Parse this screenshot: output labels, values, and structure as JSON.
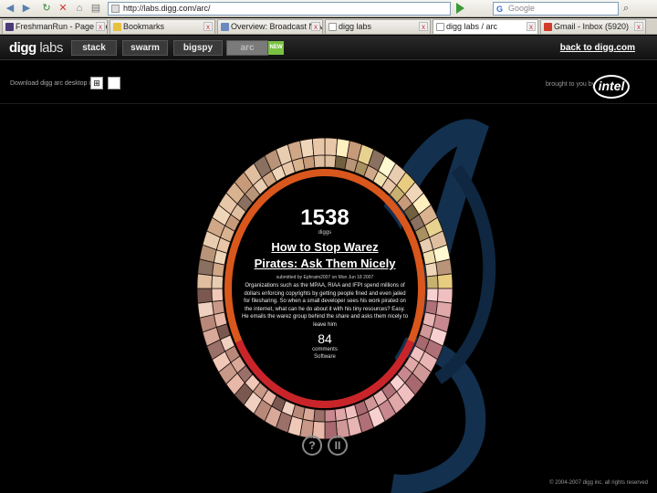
{
  "browser": {
    "url": "http://labs.digg.com/arc/",
    "search_placeholder": "Google",
    "search_engine_letter": "G",
    "tabs": [
      {
        "label": "FreshmanRun - Page ahead bring",
        "color": "#4a3a7a"
      },
      {
        "label": "Bookmarks",
        "color": "#e8c040"
      },
      {
        "label": "Overview: Broadcast Navigation",
        "color": "#6a8ac0"
      },
      {
        "label": "digg labs",
        "color": "#ffffff"
      },
      {
        "label": "digg labs / arc",
        "color": "#ffffff"
      },
      {
        "label": "Gmail - Inbox (5920)",
        "color": "#d23a2a"
      }
    ]
  },
  "header": {
    "logo_digg": "digg",
    "logo_labs": "labs",
    "nav": [
      {
        "label": "stack"
      },
      {
        "label": "swarm"
      },
      {
        "label": "bigspy"
      },
      {
        "label": "arc"
      }
    ],
    "new_badge": "NEW",
    "back_link": "back to digg.com"
  },
  "subbar": {
    "download_text": "Download digg arc desktop in air",
    "brought_by": "brought to you by",
    "sponsor": "intel"
  },
  "story": {
    "digg_count": "1538",
    "diggs_label": "diggs",
    "title_line1": "How to Stop Warez",
    "title_line2": "Pirates: Ask Them Nicely",
    "submitted": "submitted by Ephraim2007 on Mon Jun 18 2007",
    "description": "Organizations such as the MPAA, RIAA and IFPI spend millions of dollars enforcing copyrights by getting people fined and even jailed for filesharing. So when a small developer sees his work pirated on the internet, what can he do about it with his tiny resources? Easy. He emails the warez group behind the share and asks them nicely to leave him",
    "comments_count": "84",
    "comments_label": "comments",
    "category": "Software"
  },
  "controls": {
    "help_symbol": "?",
    "pause_symbol": "II"
  },
  "footer": {
    "copyright": "© 2004-2007 digg inc. all rights reserved"
  },
  "colors": {
    "background": "#000000",
    "swirl": "#1a3a5c",
    "ring_inner": "#d9571c",
    "ring_inner_red": "#c8242a",
    "new_badge": "#7ac143"
  }
}
